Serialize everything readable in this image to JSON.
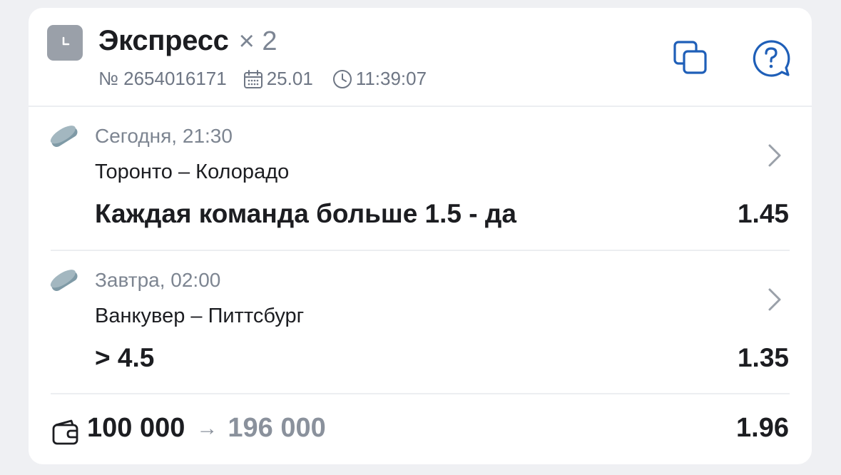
{
  "header": {
    "title": "Экспресс",
    "multiplier": "× 2",
    "bet_number": "№ 2654016171",
    "date": "25.01",
    "time": "11:39:07"
  },
  "events": [
    {
      "sport_icon": "hockey-puck-icon",
      "time": "Сегодня, 21:30",
      "teams": "Торонто – Колорадо",
      "market": "Каждая команда больше 1.5 - да",
      "odds": "1.45"
    },
    {
      "sport_icon": "hockey-puck-icon",
      "time": "Завтра, 02:00",
      "teams": "Ванкувер – Питтсбург",
      "market": "> 4.5",
      "odds": "1.35"
    }
  ],
  "footer": {
    "stake": "100 000",
    "arrow": "→",
    "payout": "196 000",
    "total_odds": "1.96"
  },
  "colors": {
    "accent": "#1f5fb8",
    "icon_gray": "#9aa0a9",
    "puck": "#7f9aa6",
    "text_primary": "#1c1d21",
    "text_secondary": "#7d8591"
  }
}
